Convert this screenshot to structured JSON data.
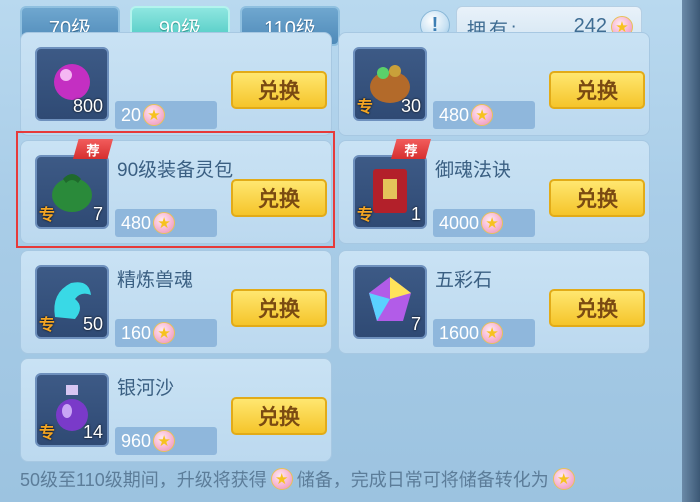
{
  "tabs": [
    {
      "label": "70级",
      "active": false
    },
    {
      "label": "90级",
      "active": true
    },
    {
      "label": "110级",
      "active": false
    }
  ],
  "info_icon": "!",
  "owned": {
    "label": "拥有:",
    "value": "242"
  },
  "items": [
    {
      "name": "",
      "count": "800",
      "price": "20",
      "recommended": false,
      "exclusive": false,
      "art": "purple-orb-icon"
    },
    {
      "name": "",
      "count": "30",
      "price": "480",
      "recommended": false,
      "exclusive": true,
      "art": "treasure-pot-icon"
    },
    {
      "name": "90级装备灵包",
      "count": "7",
      "price": "480",
      "recommended": true,
      "exclusive": true,
      "art": "green-bag-icon"
    },
    {
      "name": "御魂法诀",
      "count": "1",
      "price": "4000",
      "recommended": true,
      "exclusive": true,
      "art": "red-book-icon"
    },
    {
      "name": "精炼兽魂",
      "count": "50",
      "price": "160",
      "recommended": false,
      "exclusive": true,
      "art": "beast-soul-icon"
    },
    {
      "name": "五彩石",
      "count": "7",
      "price": "1600",
      "recommended": false,
      "exclusive": false,
      "art": "rainbow-stone-icon"
    },
    {
      "name": "银河沙",
      "count": "14",
      "price": "960",
      "recommended": false,
      "exclusive": true,
      "art": "potion-vase-icon"
    }
  ],
  "labels": {
    "exchange": "兑换",
    "recommend": "荐",
    "exclusive": "专"
  },
  "bottom_note": {
    "part1": "50级至110级期间，升级将获得",
    "part2": "储备，完成日常可将储备转化为"
  }
}
